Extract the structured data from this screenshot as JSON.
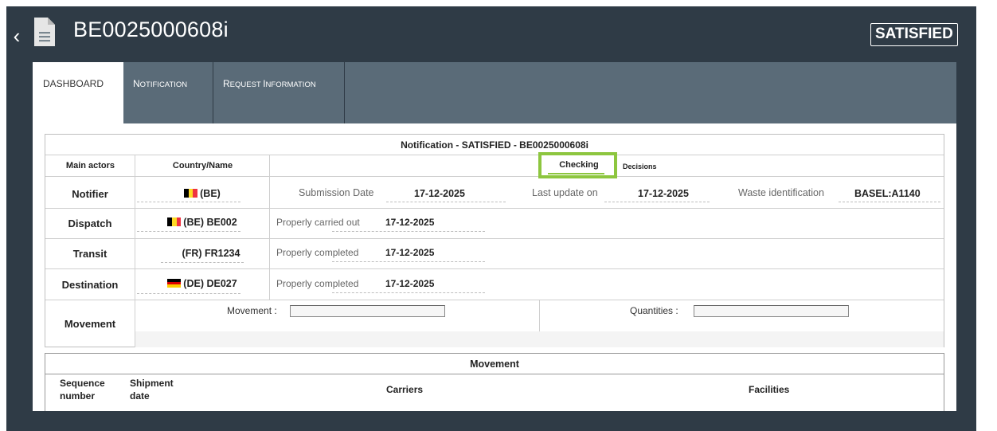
{
  "header": {
    "back_glyph": "‹",
    "title": "BE0025000608i",
    "status": "SATISFIED"
  },
  "tabs": {
    "dashboard": "DASHBOARD",
    "notification_first": "N",
    "notification_rest": "OTIFICATION",
    "request_first1": "R",
    "request_rest1": "EQUEST ",
    "request_first2": "I",
    "request_rest2": "NFORMATION"
  },
  "summary": {
    "caption": "Notification - SATISFIED - BE0025000608i",
    "col_main_actors": "Main actors",
    "col_country_name": "Country/Name",
    "tab_checking": "Checking",
    "tab_decisions": "Decisions",
    "notifier": {
      "label": "Notifier",
      "country": "(BE)",
      "submission_label": "Submission Date",
      "submission_date": "17-12-2025",
      "last_update_label": "Last update on",
      "last_update": "17-12-2025",
      "waste_label": "Waste identification",
      "waste_value": "BASEL:A1140"
    },
    "dispatch": {
      "label": "Dispatch",
      "country": "(BE) BE002",
      "status_label": "Properly carried out",
      "date": "17-12-2025"
    },
    "transit": {
      "label": "Transit",
      "country": "(FR) FR1234",
      "status_label": "Properly completed",
      "date": "17-12-2025"
    },
    "destination": {
      "label": "Destination",
      "country": "(DE) DE027",
      "status_label": "Properly completed",
      "date": "17-12-2025"
    },
    "movement": {
      "label": "Movement",
      "movement_label": "Movement :",
      "movement_value": "",
      "quantities_label": "Quantities :",
      "quantities_value": ""
    }
  },
  "movement_table": {
    "caption": "Movement",
    "col_sequence_1": "Sequence",
    "col_sequence_2": "number",
    "col_shipment_1": "Shipment",
    "col_shipment_2": "date",
    "col_carriers": "Carriers",
    "col_facilities": "Facilities"
  },
  "colors": {
    "frame": "#2f3b46",
    "tabbar": "#5a6b78",
    "highlight": "#8dc63f",
    "be_flag": [
      "#000000",
      "#fdda24",
      "#ef3340"
    ],
    "de_flag": [
      "#000000",
      "#dd0000",
      "#ffce00"
    ]
  },
  "icons": {
    "back": "chevron-left-icon",
    "document": "document-icon",
    "be_flag": "belgium-flag-icon",
    "de_flag": "germany-flag-icon"
  }
}
